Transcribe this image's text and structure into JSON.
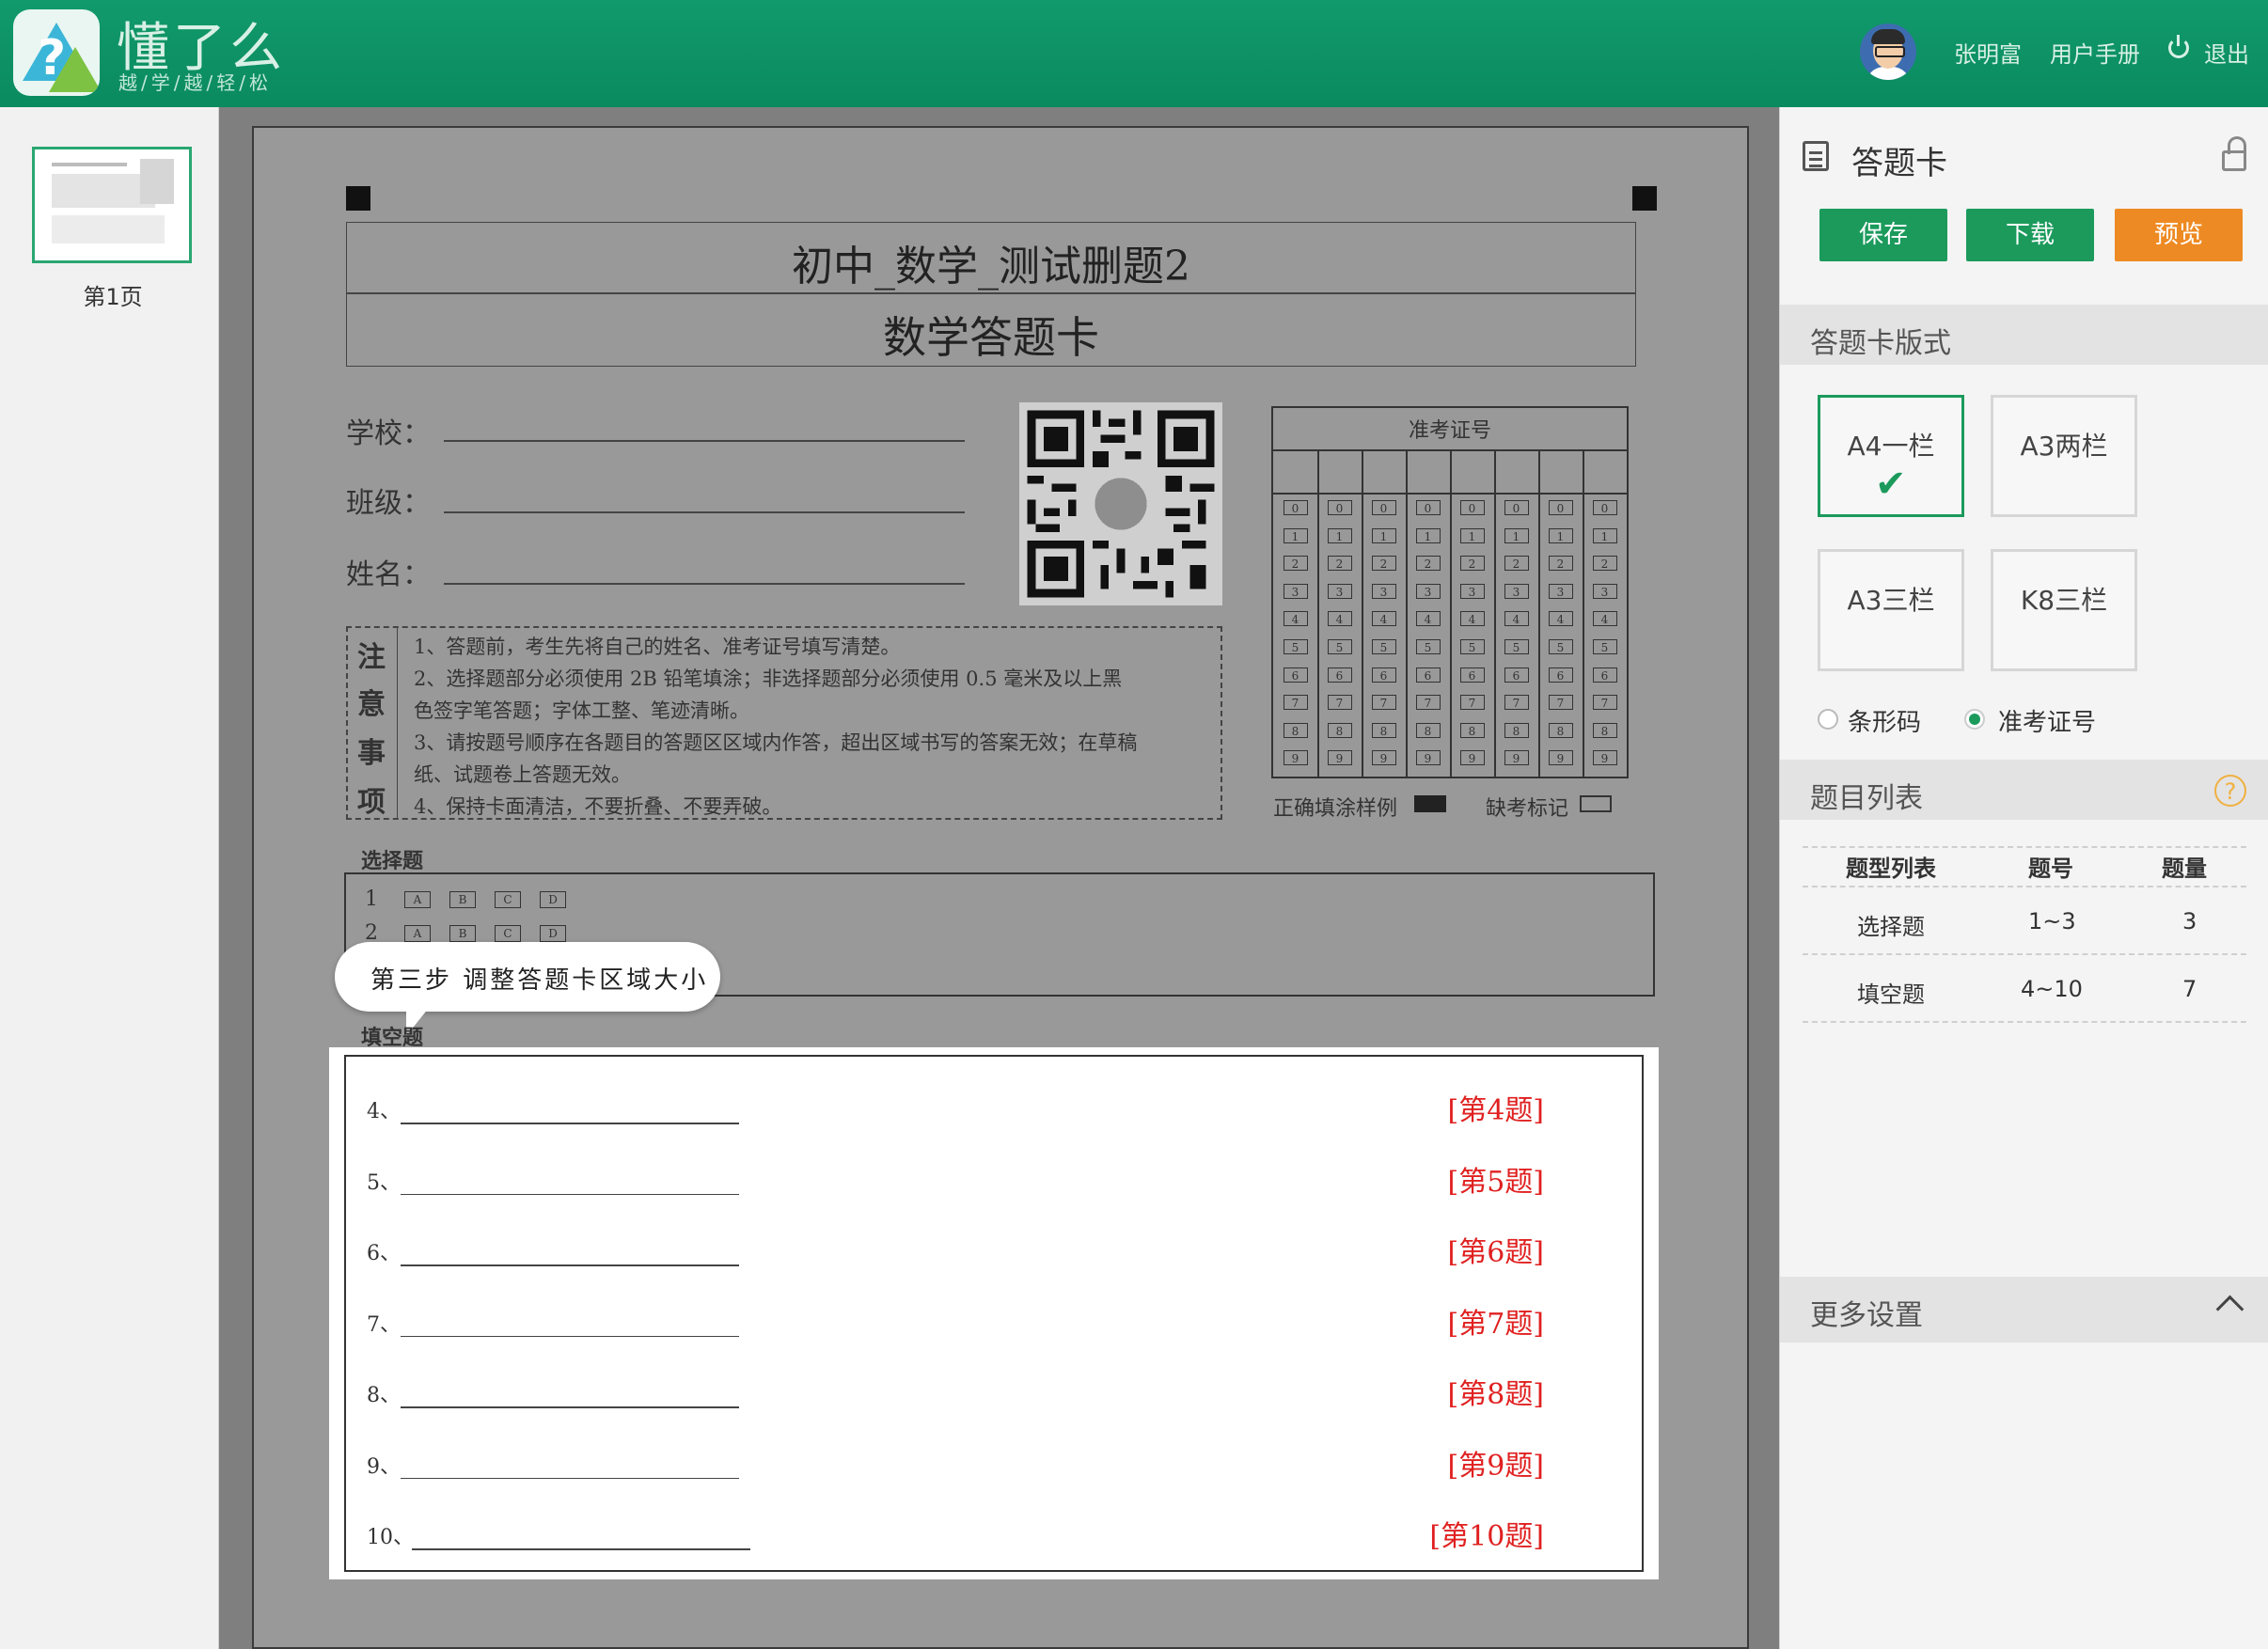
{
  "header": {
    "brand_name": "懂了么",
    "brand_slogan": "越/学/越/轻/松",
    "user_name": "张明富",
    "user_manual": "用户手册",
    "logout": "退出",
    "color": "#0f9467"
  },
  "thumbnails": [
    {
      "label": "第1页"
    }
  ],
  "paper": {
    "exam_title": "初中_数学_测试删题2",
    "card_title": "数学答题卡",
    "fields": [
      {
        "label": "学校："
      },
      {
        "label": "班级："
      },
      {
        "label": "姓名："
      }
    ],
    "exam_no": {
      "title": "准考证号",
      "columns": 8,
      "digits": [
        "0",
        "1",
        "2",
        "3",
        "4",
        "5",
        "6",
        "7",
        "8",
        "9"
      ]
    },
    "legend": {
      "fill_label": "正确填涂样例",
      "absent_label": "缺考标记"
    },
    "notes": {
      "heading": [
        "注",
        "意",
        "事",
        "项"
      ],
      "lines": [
        "1、答题前，考生先将自己的姓名、准考证号填写清楚。",
        "2、选择题部分必须使用 2B 铅笔填涂；非选择题部分必须使用 0.5 毫米及以上黑",
        "色签字笔答题；字体工整、笔迹清晰。",
        "3、请按题号顺序在各题目的答题区区域内作答，超出区域书写的答案无效；在草稿",
        "纸、试题卷上答题无效。",
        "4、保持卡面清洁，不要折叠、不要弄破。"
      ]
    },
    "choice": {
      "label": "选择题",
      "rows": [
        {
          "num": "1",
          "options": [
            "A",
            "B",
            "C",
            "D"
          ]
        },
        {
          "num": "2",
          "options": [
            "A",
            "B",
            "C",
            "D"
          ]
        }
      ]
    },
    "tooltip": "第三步 调整答题卡区域大小",
    "blank": {
      "label": "填空题",
      "questions": [
        {
          "num": "4、",
          "tag": "[第4题]"
        },
        {
          "num": "5、",
          "tag": "[第5题]"
        },
        {
          "num": "6、",
          "tag": "[第6题]"
        },
        {
          "num": "7、",
          "tag": "[第7题]"
        },
        {
          "num": "8、",
          "tag": "[第8题]"
        },
        {
          "num": "9、",
          "tag": "[第9题]"
        },
        {
          "num": "10、",
          "tag": "[第10题]"
        }
      ]
    }
  },
  "right_panel": {
    "title": "答题卡",
    "buttons": {
      "save": "保存",
      "download": "下载",
      "preview": "预览"
    },
    "layout_section": "答题卡版式",
    "layouts": [
      {
        "label": "A4一栏",
        "selected": true
      },
      {
        "label": "A3两栏",
        "selected": false
      },
      {
        "label": "A3三栏",
        "selected": false
      },
      {
        "label": "K8三栏",
        "selected": false
      }
    ],
    "id_mode": [
      {
        "label": "条形码",
        "checked": false
      },
      {
        "label": "准考证号",
        "checked": true
      }
    ],
    "question_list_section": "题目列表",
    "help": "?",
    "table": {
      "headers": [
        "题型列表",
        "题号",
        "题量"
      ],
      "rows": [
        [
          "选择题",
          "1~3",
          "3"
        ],
        [
          "填空题",
          "4~10",
          "7"
        ]
      ]
    },
    "more_settings": "更多设置"
  }
}
